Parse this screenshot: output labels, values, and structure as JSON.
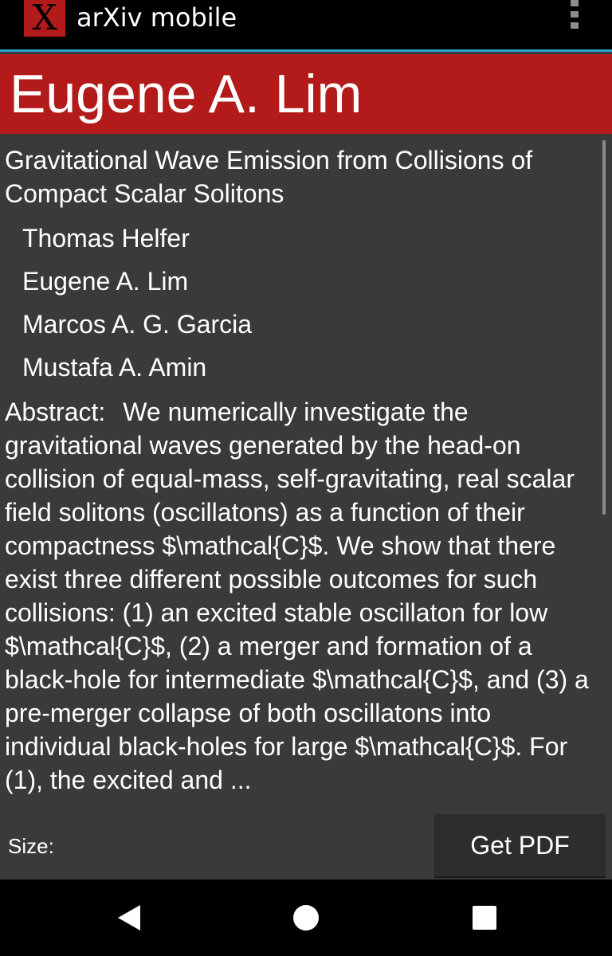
{
  "app": {
    "logo_text": "X",
    "title": "arXiv mobile",
    "menu_icon": "overflow-menu-icon"
  },
  "header": {
    "author_name": "Eugene A. Lim"
  },
  "paper": {
    "title": "Gravitational Wave Emission from Collisions of Compact Scalar Solitons",
    "authors": [
      "Thomas Helfer",
      "Eugene A. Lim",
      "Marcos A. G. Garcia",
      "Mustafa A. Amin"
    ],
    "abstract_label": "Abstract:",
    "abstract_text": "We numerically investigate the gravitational waves generated by the head-on collision of equal-mass, self-gravitating, real scalar field solitons (oscillatons) as a function of their compactness $\\mathcal{C}$. We show that there exist three different possible outcomes for such collisions: (1) an excited stable oscillaton for low $\\mathcal{C}$, (2) a merger and formation of a black-hole for intermediate $\\mathcal{C}$, and (3) a pre-merger collapse of both oscillatons into individual black-holes for large $\\mathcal{C}$. For (1), the excited and ..."
  },
  "footer": {
    "size_label": "Size:",
    "get_pdf_label": "Get PDF"
  },
  "colors": {
    "brand_red": "#b31b1b",
    "background": "#3b3a39",
    "accent_line": "#2ba6cc"
  },
  "nav": {
    "back_icon": "back-triangle-icon",
    "home_icon": "home-circle-icon",
    "recent_icon": "recent-apps-square-icon"
  }
}
